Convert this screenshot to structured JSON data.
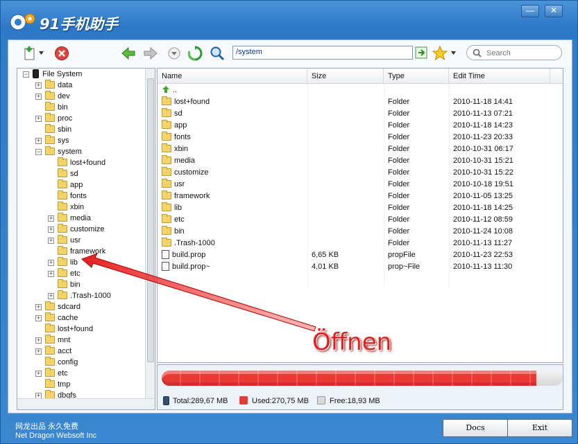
{
  "app": {
    "title": "91手机助手",
    "minimize_label": "—",
    "close_label": "✕"
  },
  "toolbar": {
    "path": "/system",
    "search_placeholder": "Search"
  },
  "tree": {
    "root_label": "File System",
    "items": [
      {
        "label": "data"
      },
      {
        "label": "dev"
      },
      {
        "label": "bin"
      },
      {
        "label": "proc"
      },
      {
        "label": "sbin"
      },
      {
        "label": "sys"
      },
      {
        "label": "system"
      },
      {
        "label": "lost+found"
      },
      {
        "label": "sd"
      },
      {
        "label": "app"
      },
      {
        "label": "fonts"
      },
      {
        "label": "xbin"
      },
      {
        "label": "media"
      },
      {
        "label": "customize"
      },
      {
        "label": "usr"
      },
      {
        "label": "framework"
      },
      {
        "label": "lib"
      },
      {
        "label": "etc"
      },
      {
        "label": "bin"
      },
      {
        "label": ".Trash-1000"
      },
      {
        "label": "sdcard"
      },
      {
        "label": "cache"
      },
      {
        "label": "lost+found"
      },
      {
        "label": "mnt"
      },
      {
        "label": "acct"
      },
      {
        "label": "config"
      },
      {
        "label": "etc"
      },
      {
        "label": "tmp"
      },
      {
        "label": "dbgfs"
      }
    ]
  },
  "list": {
    "columns": [
      "Name",
      "Size",
      "Type",
      "Edit Time"
    ],
    "up_label": "..",
    "rows": [
      {
        "name": "lost+found",
        "size": "",
        "type": "Folder",
        "time": "2010-11-18 14:41"
      },
      {
        "name": "sd",
        "size": "",
        "type": "Folder",
        "time": "2010-11-13 07:21"
      },
      {
        "name": "app",
        "size": "",
        "type": "Folder",
        "time": "2010-11-18 14:23"
      },
      {
        "name": "fonts",
        "size": "",
        "type": "Folder",
        "time": "2010-11-23 20:33"
      },
      {
        "name": "xbin",
        "size": "",
        "type": "Folder",
        "time": "2010-10-31 06:17"
      },
      {
        "name": "media",
        "size": "",
        "type": "Folder",
        "time": "2010-10-31 15:21"
      },
      {
        "name": "customize",
        "size": "",
        "type": "Folder",
        "time": "2010-10-31 15:22"
      },
      {
        "name": "usr",
        "size": "",
        "type": "Folder",
        "time": "2010-10-18 19:51"
      },
      {
        "name": "framework",
        "size": "",
        "type": "Folder",
        "time": "2010-11-05 13:25"
      },
      {
        "name": "lib",
        "size": "",
        "type": "Folder",
        "time": "2010-11-18 14:25"
      },
      {
        "name": "etc",
        "size": "",
        "type": "Folder",
        "time": "2010-11-12 08:59"
      },
      {
        "name": "bin",
        "size": "",
        "type": "Folder",
        "time": "2010-11-24 10:08"
      },
      {
        "name": ".Trash-1000",
        "size": "",
        "type": "Folder",
        "time": "2010-11-13 11:27"
      },
      {
        "name": "build.prop",
        "size": "6,65 KB",
        "type": "propFile",
        "time": "2010-11-23 22:53"
      },
      {
        "name": "build.prop~",
        "size": "4,01 KB",
        "type": "prop~File",
        "time": "2010-11-13 11:30"
      }
    ]
  },
  "storage": {
    "total": "Total:289,67 MB",
    "used": "Used:270,75 MB",
    "free": "Free:18,93 MB",
    "used_fraction": 0.9347,
    "used_color": "#e73a33",
    "free_color": "#d8d8d8"
  },
  "footer": {
    "line1": "网龙出品 永久免费",
    "line2": "Net Dragon Websoft Inc",
    "docs_label": "Docs",
    "exit_label": "Exit"
  },
  "annotation": {
    "text": "Öffnen",
    "color": "#e02020"
  }
}
